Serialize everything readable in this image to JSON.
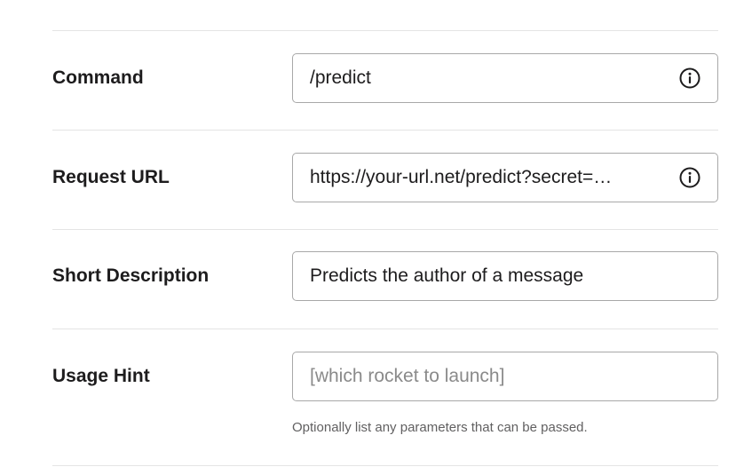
{
  "form": {
    "command": {
      "label": "Command",
      "value": "/predict",
      "icon": "info-icon"
    },
    "request_url": {
      "label": "Request URL",
      "value": "https://your-url.net/predict?secret=…",
      "icon": "info-icon"
    },
    "short_description": {
      "label": "Short Description",
      "value": "Predicts the author of a message"
    },
    "usage_hint": {
      "label": "Usage Hint",
      "value": "",
      "placeholder": "[which rocket to launch]",
      "help_text": "Optionally list any parameters that can be passed."
    }
  },
  "colors": {
    "text": "#1d1c1d",
    "border": "#a8a8a8",
    "divider": "#e4e4e4",
    "placeholder": "#8a8a8a",
    "help_text": "#616061"
  }
}
